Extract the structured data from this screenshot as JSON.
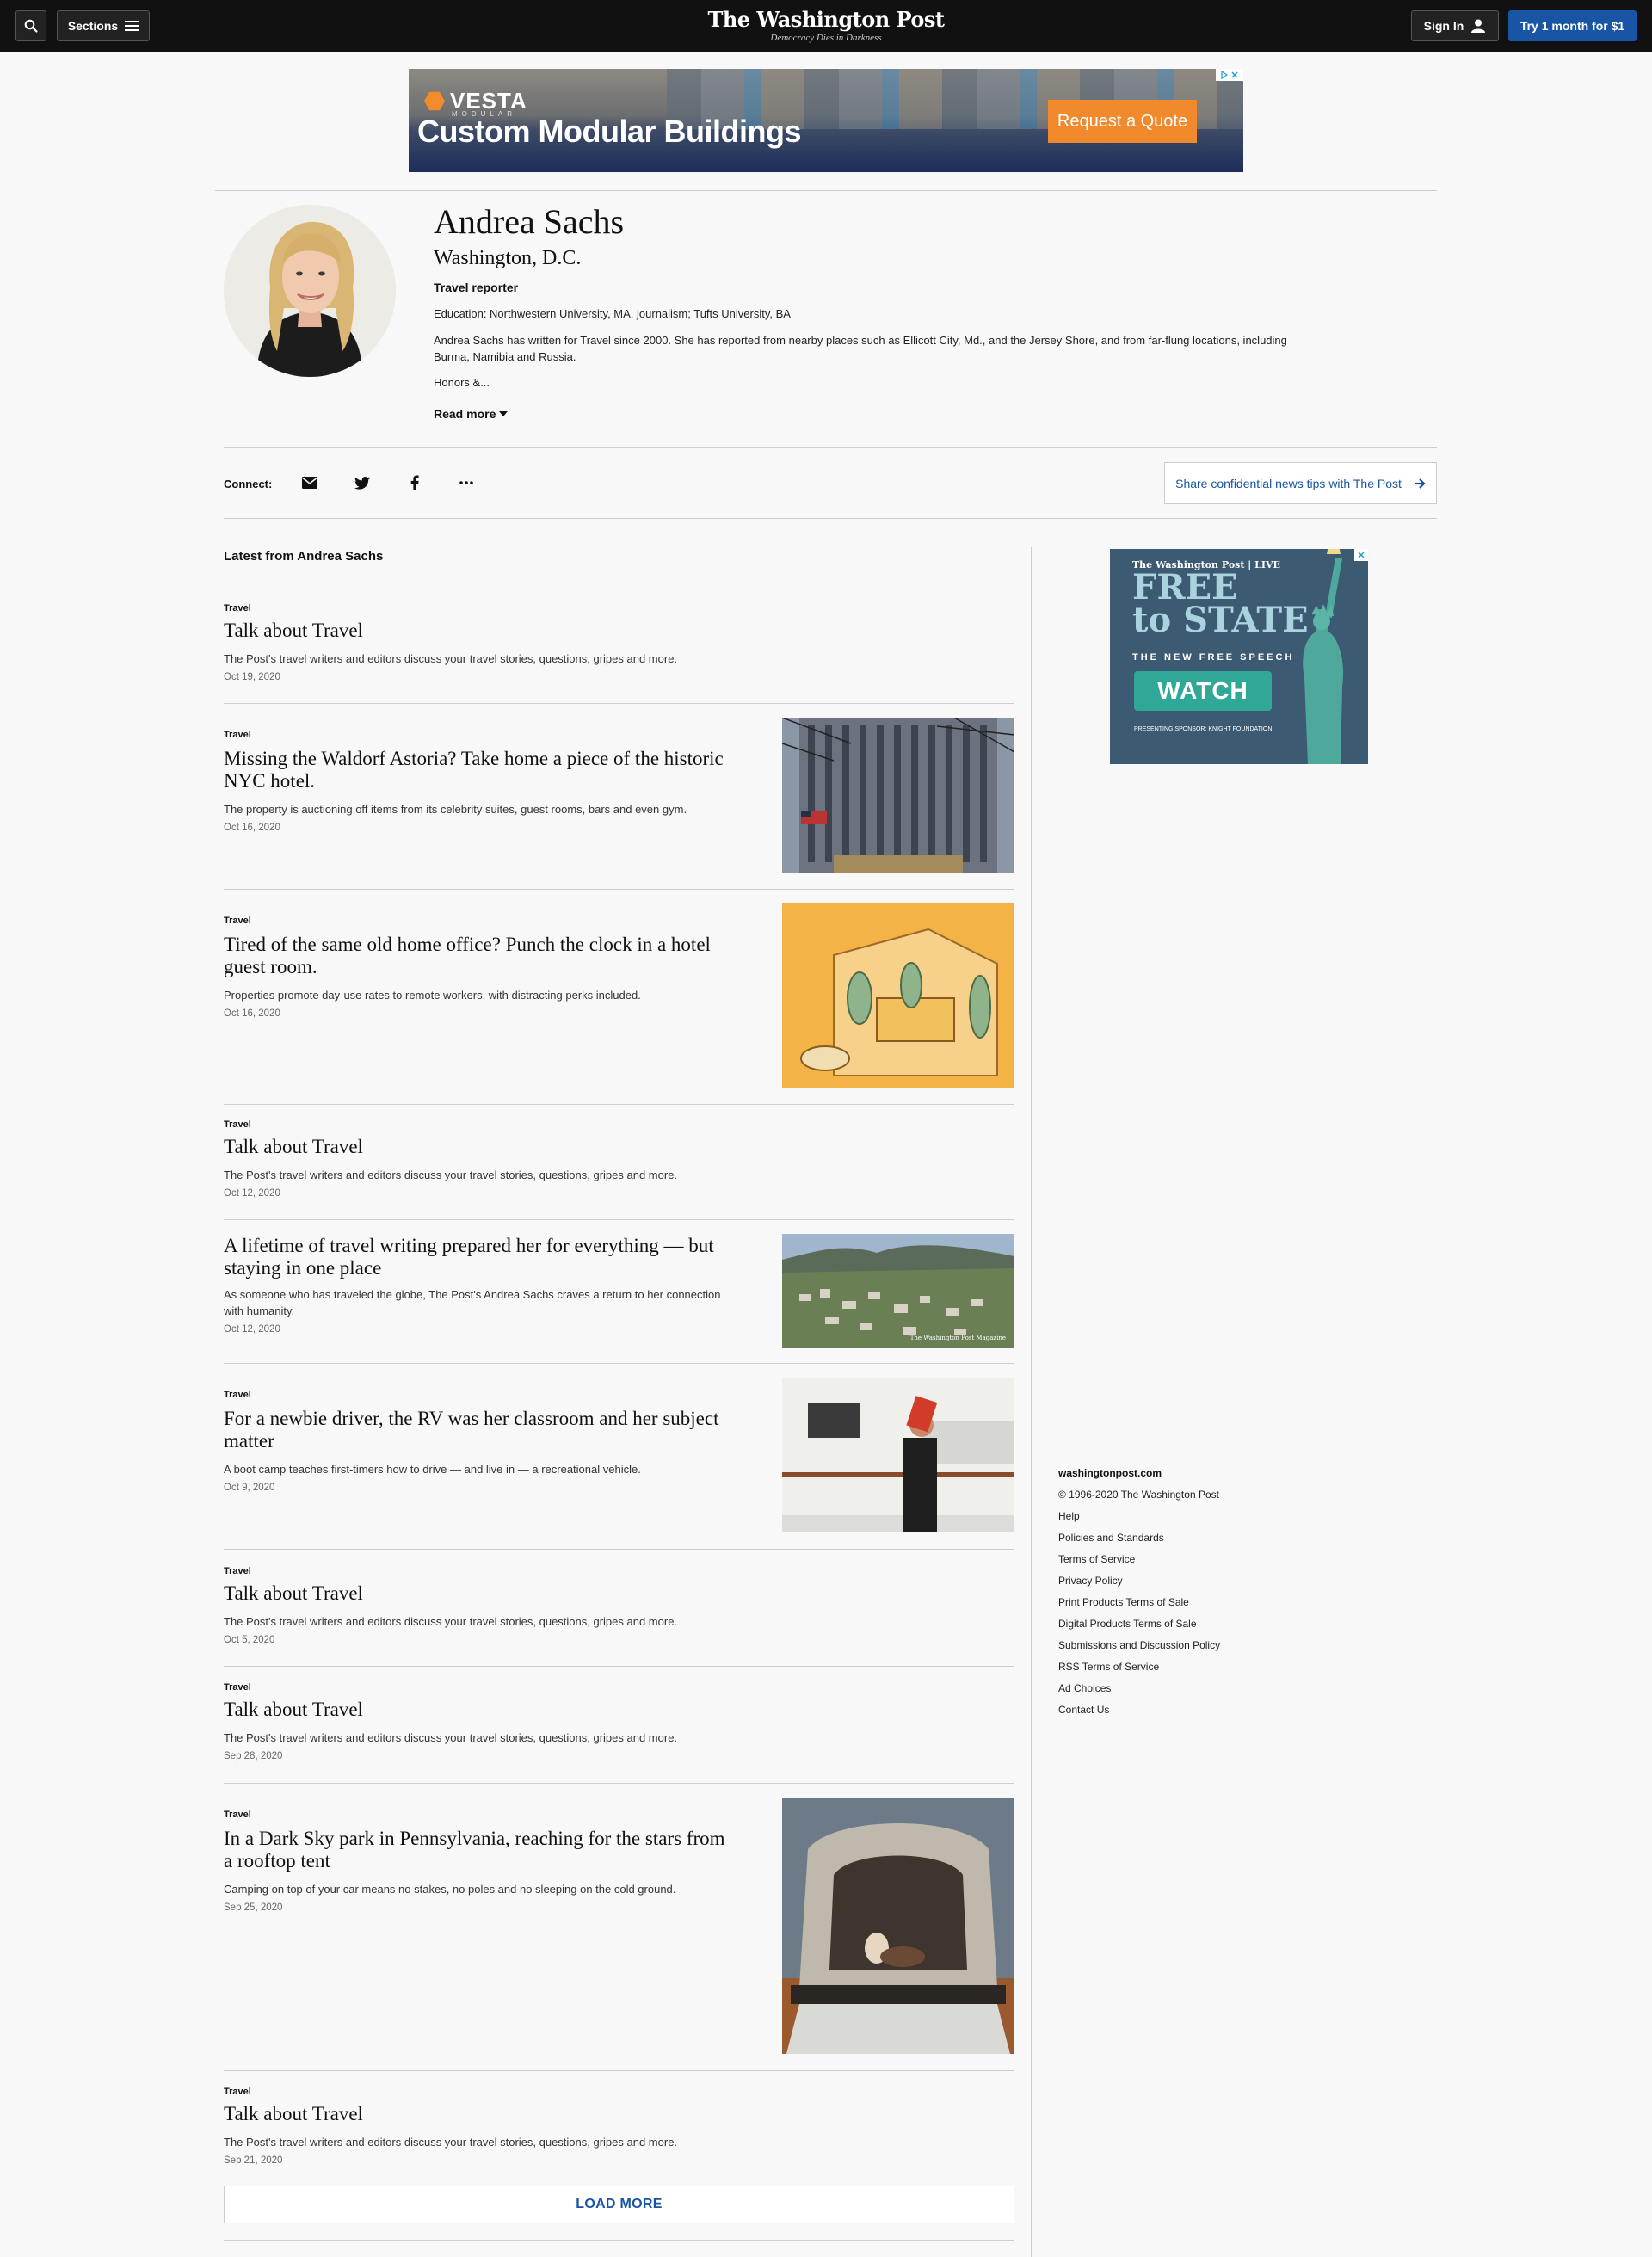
{
  "nav": {
    "sections_label": "Sections",
    "signin_label": "Sign In",
    "try_label": "Try 1 month for $1",
    "logo": "The Washington Post",
    "tagline": "Democracy Dies in Darkness"
  },
  "top_ad": {
    "brand": "VESTA",
    "brand_sub": "MODULAR",
    "headline": "Custom Modular Buildings",
    "cta": "Request a Quote"
  },
  "profile": {
    "name": "Andrea Sachs",
    "location": "Washington, D.C.",
    "role": "Travel reporter",
    "education": "Education: Northwestern University, MA, journalism; Tufts University, BA",
    "bio": "Andrea Sachs has written for Travel since 2000. She has reported from nearby places such as Ellicott City, Md., and the Jersey Shore, and from far-flung locations, including Burma, Namibia and Russia.",
    "honors": "Honors &...",
    "read_more": "Read more"
  },
  "connect": {
    "label": "Connect:",
    "tips": "Share confidential news tips with The Post"
  },
  "feed": {
    "heading": "Latest from Andrea Sachs",
    "load_more": "LOAD MORE",
    "stories": [
      {
        "kicker": "Travel",
        "headline": "Talk about Travel",
        "blurb": "The Post's travel writers and editors discuss your travel stories, questions, gripes and more.",
        "date": "Oct 19, 2020"
      },
      {
        "kicker": "Travel",
        "headline": "Missing the Waldorf Astoria? Take home a piece of the historic NYC hotel.",
        "blurb": "The property is auctioning off items from its celebrity suites, guest rooms, bars and even gym.",
        "date": "Oct 16, 2020"
      },
      {
        "kicker": "Travel",
        "headline": "Tired of the same old home office? Punch the clock in a hotel guest room.",
        "blurb": "Properties promote day-use rates to remote workers, with distracting perks included.",
        "date": "Oct 16, 2020"
      },
      {
        "kicker": "Travel",
        "headline": "Talk about Travel",
        "blurb": "The Post's travel writers and editors discuss your travel stories, questions, gripes and more.",
        "date": "Oct 12, 2020"
      },
      {
        "kicker": "",
        "headline": "A lifetime of travel writing prepared her for everything — but staying in one place",
        "blurb": "As someone who has traveled the globe, The Post's Andrea Sachs craves a return to her connection with humanity.",
        "date": "Oct 12, 2020",
        "image_credit": "The Washington Post Magazine"
      },
      {
        "kicker": "Travel",
        "headline": "For a newbie driver, the RV was her classroom and her subject matter",
        "blurb": "A boot camp teaches first-timers how to drive — and live in — a recreational vehicle.",
        "date": "Oct 9, 2020"
      },
      {
        "kicker": "Travel",
        "headline": "Talk about Travel",
        "blurb": "The Post's travel writers and editors discuss your travel stories, questions, gripes and more.",
        "date": "Oct 5, 2020"
      },
      {
        "kicker": "Travel",
        "headline": "Talk about Travel",
        "blurb": "The Post's travel writers and editors discuss your travel stories, questions, gripes and more.",
        "date": "Sep 28, 2020"
      },
      {
        "kicker": "Travel",
        "headline": "In a Dark Sky park in Pennsylvania, reaching for the stars from a rooftop tent",
        "blurb": "Camping on top of your car means no stakes, no poles and no sleeping on the cold ground.",
        "date": "Sep 25, 2020"
      },
      {
        "kicker": "Travel",
        "headline": "Talk about Travel",
        "blurb": "The Post's travel writers and editors discuss your travel stories, questions, gripes and more.",
        "date": "Sep 21, 2020"
      }
    ]
  },
  "side_ad": {
    "brand": "The Washington Post | LIVE",
    "title_1": "FREE",
    "title_2": "to STATE",
    "subtitle": "THE NEW FREE SPEECH",
    "cta": "WATCH",
    "sponsor": "PRESENTING SPONSOR: KNIGHT FOUNDATION"
  },
  "footer": {
    "title": "washingtonpost.com",
    "items": [
      "© 1996-2020 The Washington Post",
      "Help",
      "Policies and Standards",
      "Terms of Service",
      "Privacy Policy",
      "Print Products Terms of Sale",
      "Digital Products Terms of Sale",
      "Submissions and Discussion Policy",
      "RSS Terms of Service",
      "Ad Choices",
      "Contact Us"
    ]
  },
  "colors": {
    "nav_bg": "#111111",
    "accent_blue": "#1955a5",
    "page_bg": "#f8f8f8",
    "ad_orange": "#f08a2c"
  }
}
